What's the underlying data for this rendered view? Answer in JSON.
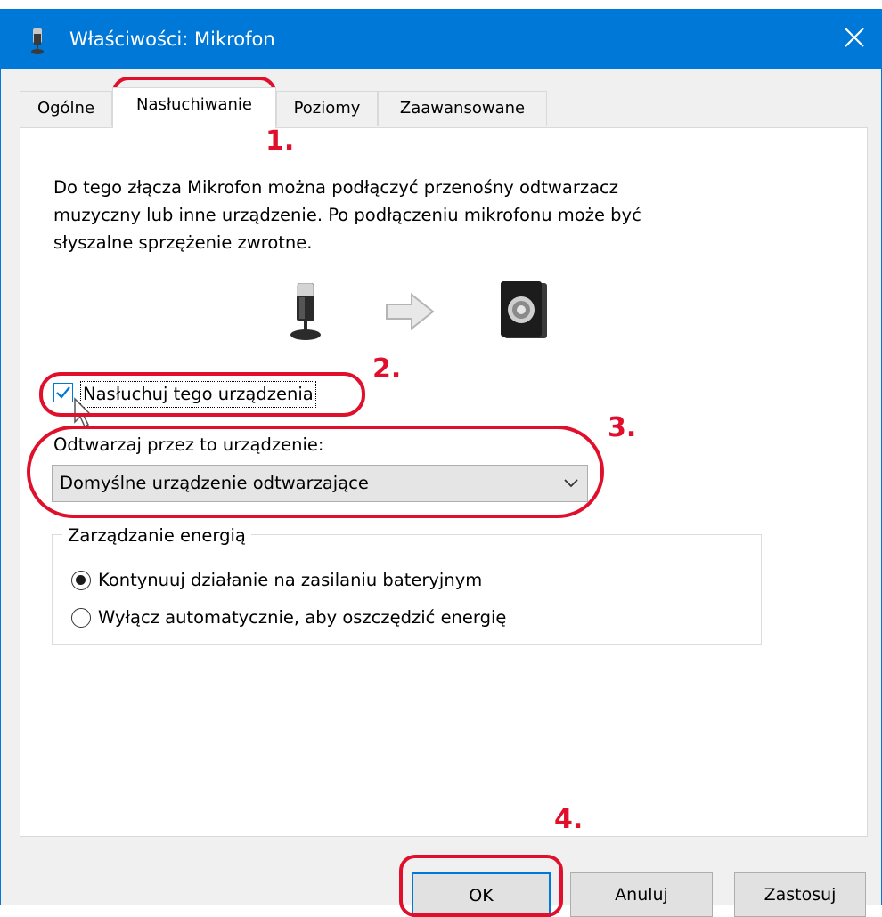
{
  "window": {
    "title": "Właściwości: Mikrofon",
    "title_icon": "microphone-icon",
    "close_icon": "close-icon",
    "accent_color": "#0078d7"
  },
  "tabs": [
    {
      "label": "Ogólne"
    },
    {
      "label": "Nasłuchiwanie",
      "active": true
    },
    {
      "label": "Poziomy"
    },
    {
      "label": "Zaawansowane"
    }
  ],
  "content": {
    "description": "Do tego złącza Mikrofon można podłączyć przenośny odtwarzacz\nmuzyczny lub inne urządzenie. Po podłączeniu mikrofonu może być\nsłyszalne sprzężenie zwrotne.",
    "icons": [
      "microphone-icon",
      "arrow-right-icon",
      "speaker-icon"
    ],
    "listen_checkbox": {
      "label": "Nasłuchuj tego urządzenia",
      "checked": true
    },
    "playback_label": "Odtwarzaj przez to urządzenie:",
    "playback_select": {
      "value": "Domyślne urządzenie odtwarzające"
    },
    "power": {
      "title": "Zarządzanie energią",
      "options": [
        {
          "label": "Kontynuuj działanie na zasilaniu bateryjnym",
          "selected": true
        },
        {
          "label": "Wyłącz automatycznie, aby oszczędzić energię",
          "selected": false
        }
      ]
    }
  },
  "buttons": {
    "ok": "OK",
    "cancel": "Anuluj",
    "apply": "Zastosuj"
  },
  "annotations": {
    "color": "#e0102d",
    "steps": [
      "1.",
      "2.",
      "3.",
      "4."
    ]
  }
}
